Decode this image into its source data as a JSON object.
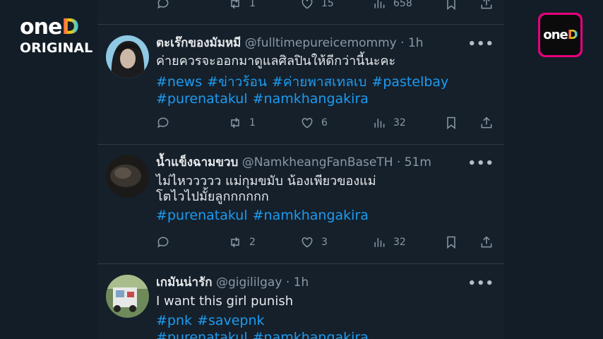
{
  "brand": {
    "logo_word": "one",
    "logo_letter": "D",
    "logo_sub": "ORIGINAL",
    "badge_word": "one",
    "badge_letter": "D",
    "accent": "#e6007e"
  },
  "top_counts": {
    "retweets": "1",
    "likes": "15",
    "views": "658"
  },
  "tweets": [
    {
      "name": "ตะเร๊กของมัมหมี",
      "handle": "@fulltimepureicemommy",
      "dot": "·",
      "time": "1h",
      "text": [
        "ค่ายควรจะออกมาดูแลศิลปินให้ดีกว่านี้นะคะ"
      ],
      "tags": [
        "#news",
        "#ข่าวร้อน",
        "#ค่ายพาสเทลเบ",
        "#pastelbay",
        "#purenatakul",
        "#namkhangakira"
      ],
      "retweets": "1",
      "likes": "6",
      "views": "32"
    },
    {
      "name": "น้ำแข็งฉามขวบ",
      "handle": "@NamkheangFanBaseTH",
      "dot": "·",
      "time": "51m",
      "text": [
        "ไม่ไหววววว แม่กุมขมับ น้องเพียวของแม่",
        "โตไวไปมั้ยลูกกกกกก"
      ],
      "tags": [
        "#purenatakul",
        "#namkhangakira"
      ],
      "retweets": "2",
      "likes": "3",
      "views": "32"
    },
    {
      "name": "เกมันน่ารัก",
      "handle": "@gigililgay",
      "dot": "·",
      "time": "1h",
      "text": [
        "I want this girl punish"
      ],
      "tags": [
        "#pnk",
        "#savepnk",
        "#purenatakul",
        "#namkhangakira"
      ]
    }
  ],
  "icons": {
    "reply": "reply-icon",
    "retweet": "retweet-icon",
    "like": "like-icon",
    "views": "views-icon",
    "bookmark": "bookmark-icon",
    "share": "share-icon",
    "more": "more-icon"
  }
}
